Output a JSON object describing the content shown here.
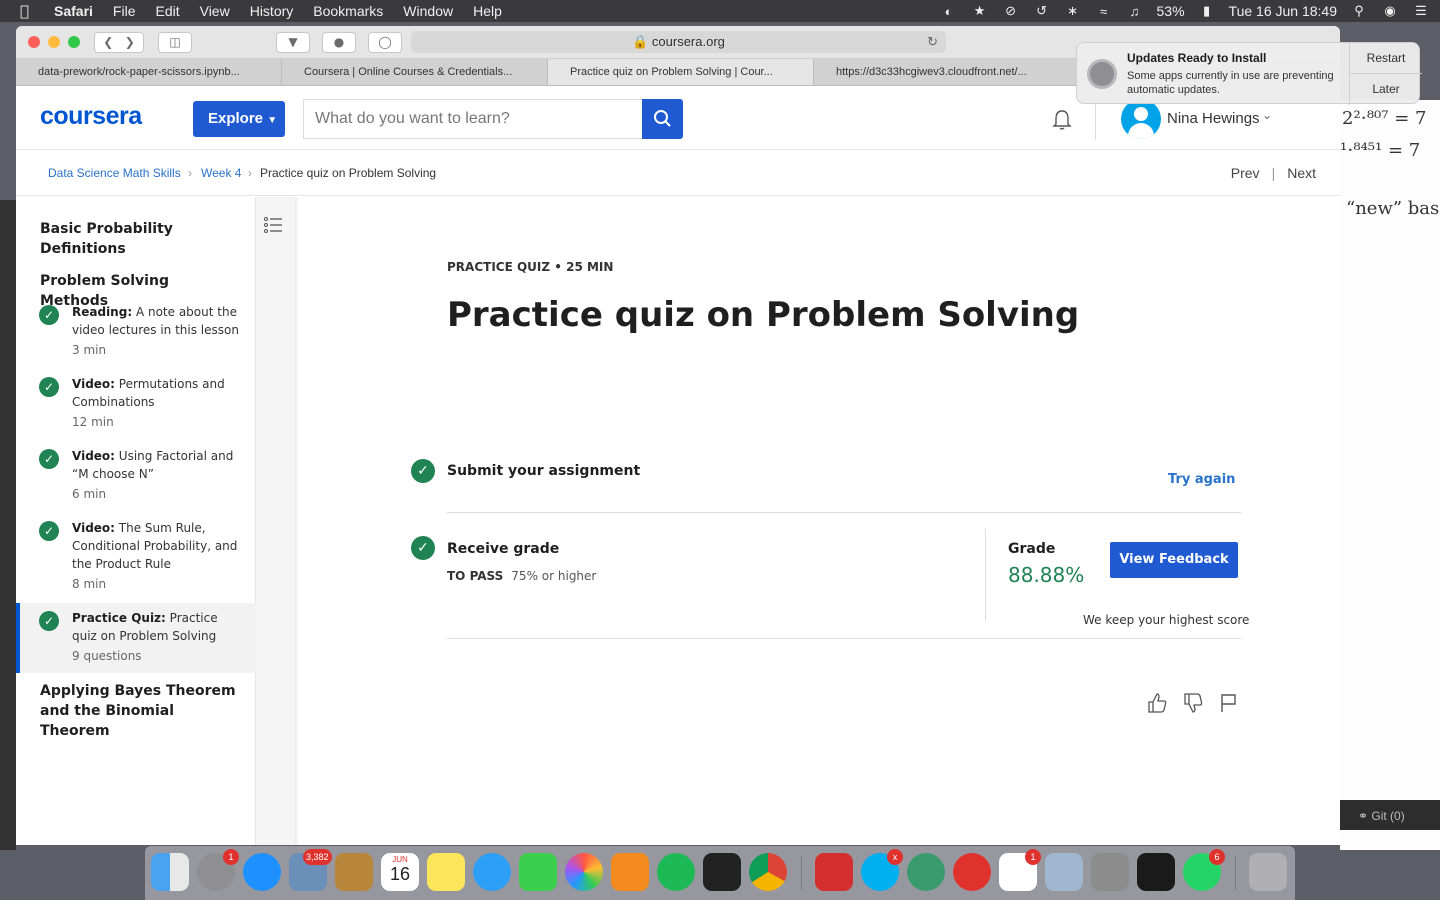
{
  "menubar": {
    "app": "Safari",
    "items": [
      "File",
      "Edit",
      "View",
      "History",
      "Bookmarks",
      "Window",
      "Help"
    ],
    "battery": "53%",
    "datetime": "Tue 16 Jun  18:49"
  },
  "browser": {
    "url": "coursera.org",
    "tabs": [
      "data-prework/rock-paper-scissors.ipynb...",
      "Coursera | Online Courses & Credentials...",
      "Practice quiz on Problem Solving | Cour...",
      "https://d3c33hcgiwev3.cloudfront.net/..."
    ]
  },
  "notification": {
    "title": "Updates Ready to Install",
    "body": "Some apps currently in use are preventing automatic updates.",
    "button_primary": "Restart",
    "button_secondary": "Later"
  },
  "header": {
    "logo": "coursera",
    "explore_label": "Explore",
    "search_placeholder": "What do you want to learn?",
    "user_name": "Nina Hewings"
  },
  "breadcrumb": {
    "course": "Data Science Math Skills",
    "week": "Week 4",
    "current": "Practice quiz on Problem Solving",
    "prev": "Prev",
    "next": "Next"
  },
  "sidebar": {
    "section_1": "Basic Probability Definitions",
    "section_2": "Problem Solving Methods",
    "items": [
      {
        "type": "Reading:",
        "title": "A note about the video lectures in this lesson",
        "meta": "3 min"
      },
      {
        "type": "Video:",
        "title": "Permutations and Combinations",
        "meta": "12 min"
      },
      {
        "type": "Video:",
        "title": "Using Factorial and “M choose N”",
        "meta": "6 min"
      },
      {
        "type": "Video:",
        "title": "The Sum Rule, Conditional Probability, and the Product Rule",
        "meta": "8 min"
      },
      {
        "type": "Practice Quiz:",
        "title": "Practice quiz on Problem Solving",
        "meta": "9 questions"
      }
    ],
    "section_3": "Applying Bayes Theorem and the Binomial Theorem"
  },
  "main": {
    "kicker": "PRACTICE QUIZ • 25 MIN",
    "title": "Practice quiz on Problem Solving",
    "step1_title": "Submit your assignment",
    "try_again": "Try again",
    "step2_title": "Receive grade",
    "to_pass_label": "TO PASS",
    "to_pass_value": "75% or higher",
    "grade_label": "Grade",
    "grade_value": "88.88%",
    "view_feedback": "View Feedback",
    "highest_note": "We keep your highest score"
  },
  "background_window": {
    "eq1": "2²⋅⁸⁰⁷ = 7",
    "eq2": "¹⋅⁸⁴⁵¹ = 7",
    "text": "“new” base",
    "git": "Git (0)"
  },
  "dock": {
    "badges": {
      "system_prefs": "1",
      "mail": "3,382",
      "skype": "x",
      "slack": "1",
      "whatsapp": "6"
    },
    "calendar_month": "JUN",
    "calendar_day": "16"
  }
}
